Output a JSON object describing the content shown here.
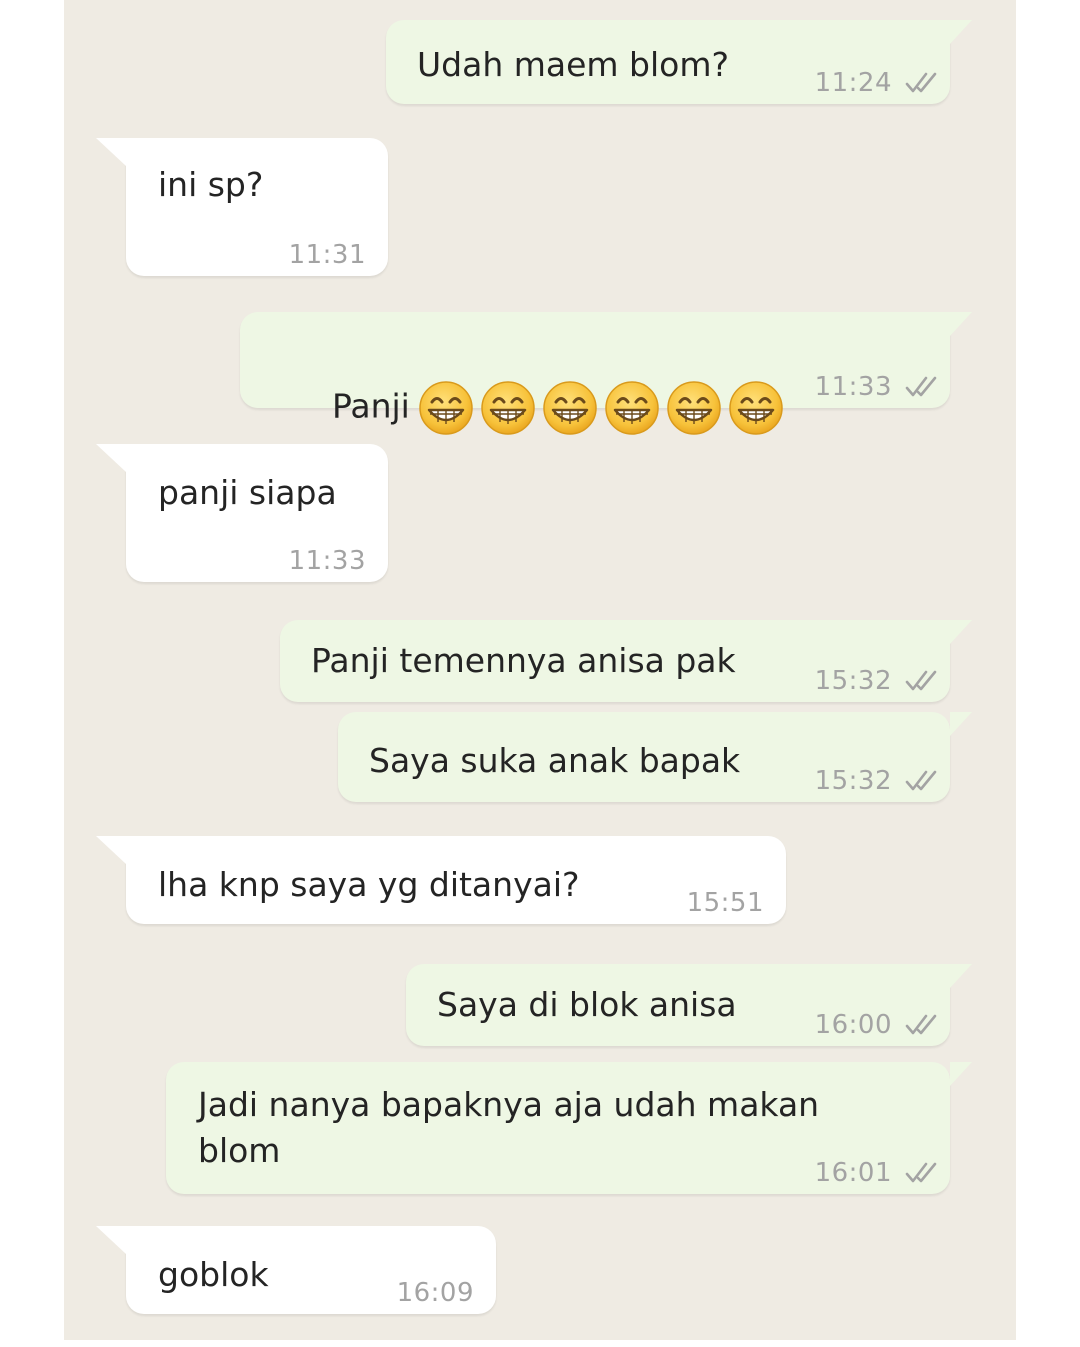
{
  "messages": [
    {
      "direction": "out",
      "text": "Udah maem blom?",
      "time": "11:24",
      "status": "read-double-check-icon"
    },
    {
      "direction": "in",
      "text": "ini sp?",
      "time": "11:31"
    },
    {
      "direction": "out",
      "text": "Panji",
      "emoji": [
        "grinning-face-icon",
        "grinning-face-icon",
        "grinning-face-icon",
        "grinning-face-icon",
        "grinning-face-icon",
        "grinning-face-icon"
      ],
      "time": "11:33",
      "status": "read-double-check-icon"
    },
    {
      "direction": "in",
      "text": "panji siapa",
      "time": "11:33"
    },
    {
      "direction": "out",
      "text": "Panji temennya anisa pak",
      "time": "15:32",
      "status": "read-double-check-icon"
    },
    {
      "direction": "out",
      "text": "Saya suka anak bapak",
      "time": "15:32",
      "status": "read-double-check-icon"
    },
    {
      "direction": "in",
      "text": "lha knp saya yg ditanyai?",
      "time": "15:51"
    },
    {
      "direction": "out",
      "text": "Saya di blok anisa",
      "time": "16:00",
      "status": "read-double-check-icon"
    },
    {
      "direction": "out",
      "text": "Jadi nanya bapaknya aja udah makan\nblom",
      "time": "16:01",
      "status": "read-double-check-icon"
    },
    {
      "direction": "in",
      "text": "goblok",
      "time": "16:09"
    }
  ],
  "colors": {
    "background": "#efebe3",
    "incoming_bubble": "#ffffff",
    "outgoing_bubble": "#eef7e4",
    "timestamp": "#a3a3a3",
    "check": "#a3a3a3"
  }
}
